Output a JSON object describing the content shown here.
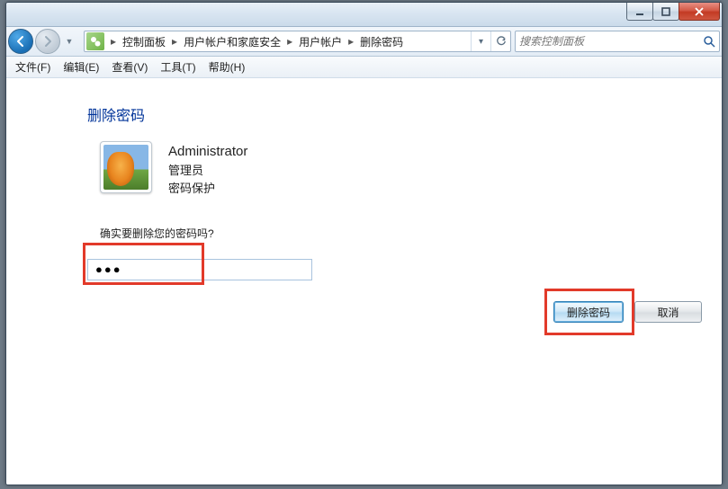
{
  "window": {
    "min_tip": "最小化",
    "max_tip": "最大化",
    "close_tip": "关闭"
  },
  "breadcrumbs": {
    "items": [
      "控制面板",
      "用户帐户和家庭安全",
      "用户帐户",
      "删除密码"
    ]
  },
  "search": {
    "placeholder": "搜索控制面板"
  },
  "menu": {
    "file": "文件(F)",
    "edit": "编辑(E)",
    "view": "查看(V)",
    "tools": "工具(T)",
    "help": "帮助(H)"
  },
  "page": {
    "title": "删除密码",
    "user_name": "Administrator",
    "user_role": "管理员",
    "user_status": "密码保护",
    "confirm_question": "确实要删除您的密码吗?",
    "password_value": "●●●"
  },
  "buttons": {
    "remove": "删除密码",
    "cancel": "取消"
  }
}
